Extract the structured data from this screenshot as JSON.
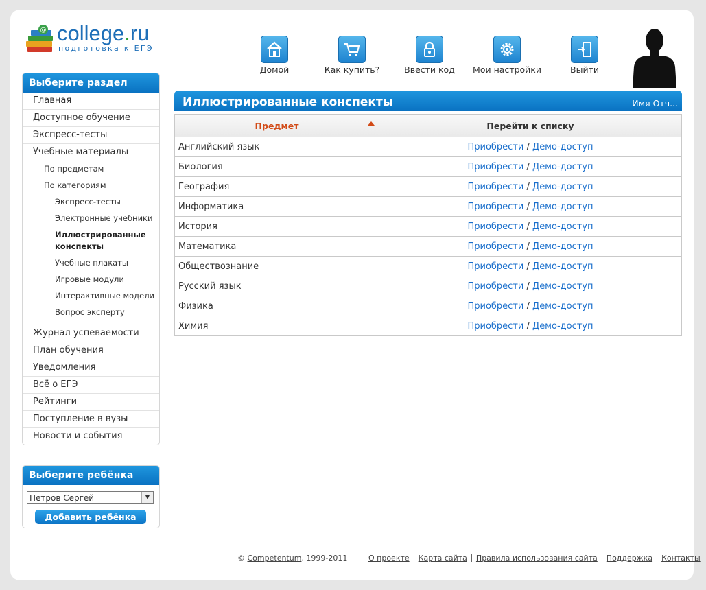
{
  "logo": {
    "title_main": "college",
    "title_dot": ".",
    "title_tld": "ru",
    "subtitle": "подготовка к ЕГЭ"
  },
  "topnav": [
    {
      "label": "Домой",
      "icon": "home-icon"
    },
    {
      "label": "Как купить?",
      "icon": "cart-icon"
    },
    {
      "label": "Ввести код",
      "icon": "lock-icon"
    },
    {
      "label": "Мои настройки",
      "icon": "gear-icon"
    },
    {
      "label": "Выйти",
      "icon": "exit-door-icon"
    }
  ],
  "sidebar": {
    "title": "Выберите раздел",
    "items_top": [
      "Главная",
      "Доступное обучение",
      "Экспресс-тесты",
      "Учебные материалы"
    ],
    "sub_level1": [
      "По предметам",
      "По категориям"
    ],
    "sub_level2": [
      "Экспресс-тесты",
      "Электронные учебники",
      "Иллюстрированные конспекты",
      "Учебные плакаты",
      "Игровые модули",
      "Интерактивные модели",
      "Вопрос эксперту"
    ],
    "items_bottom": [
      "Журнал успеваемости",
      "План обучения",
      "Уведомления",
      "Всё о ЕГЭ",
      "Рейтинги",
      "Поступление в вузы",
      "Новости и события"
    ]
  },
  "child_box": {
    "title": "Выберите ребёнка",
    "selected": "Петров Сергей",
    "add_button": "Добавить ребёнка"
  },
  "content": {
    "title": "Иллюстрированные конспекты",
    "user_name": "Имя Отч...",
    "columns": [
      "Предмет",
      "Перейти к списку"
    ],
    "buy_label": "Приобрести",
    "separator": "/",
    "demo_label": "Демо-доступ",
    "subjects": [
      "Английский язык",
      "Биология",
      "География",
      "Информатика",
      "История",
      "Математика",
      "Обществознание",
      "Русский язык",
      "Физика",
      "Химия"
    ]
  },
  "footer": {
    "copyright_symbol": "©",
    "company": "Competentum",
    "years": ", 1999-2011",
    "links": [
      "О проекте",
      "Карта сайта",
      "Правила использования сайта",
      "Поддержка",
      "Контакты"
    ]
  },
  "colors": {
    "accent_blue": "#0a72c2",
    "link_blue": "#1a6fcc",
    "sort_orange": "#d24a16"
  }
}
